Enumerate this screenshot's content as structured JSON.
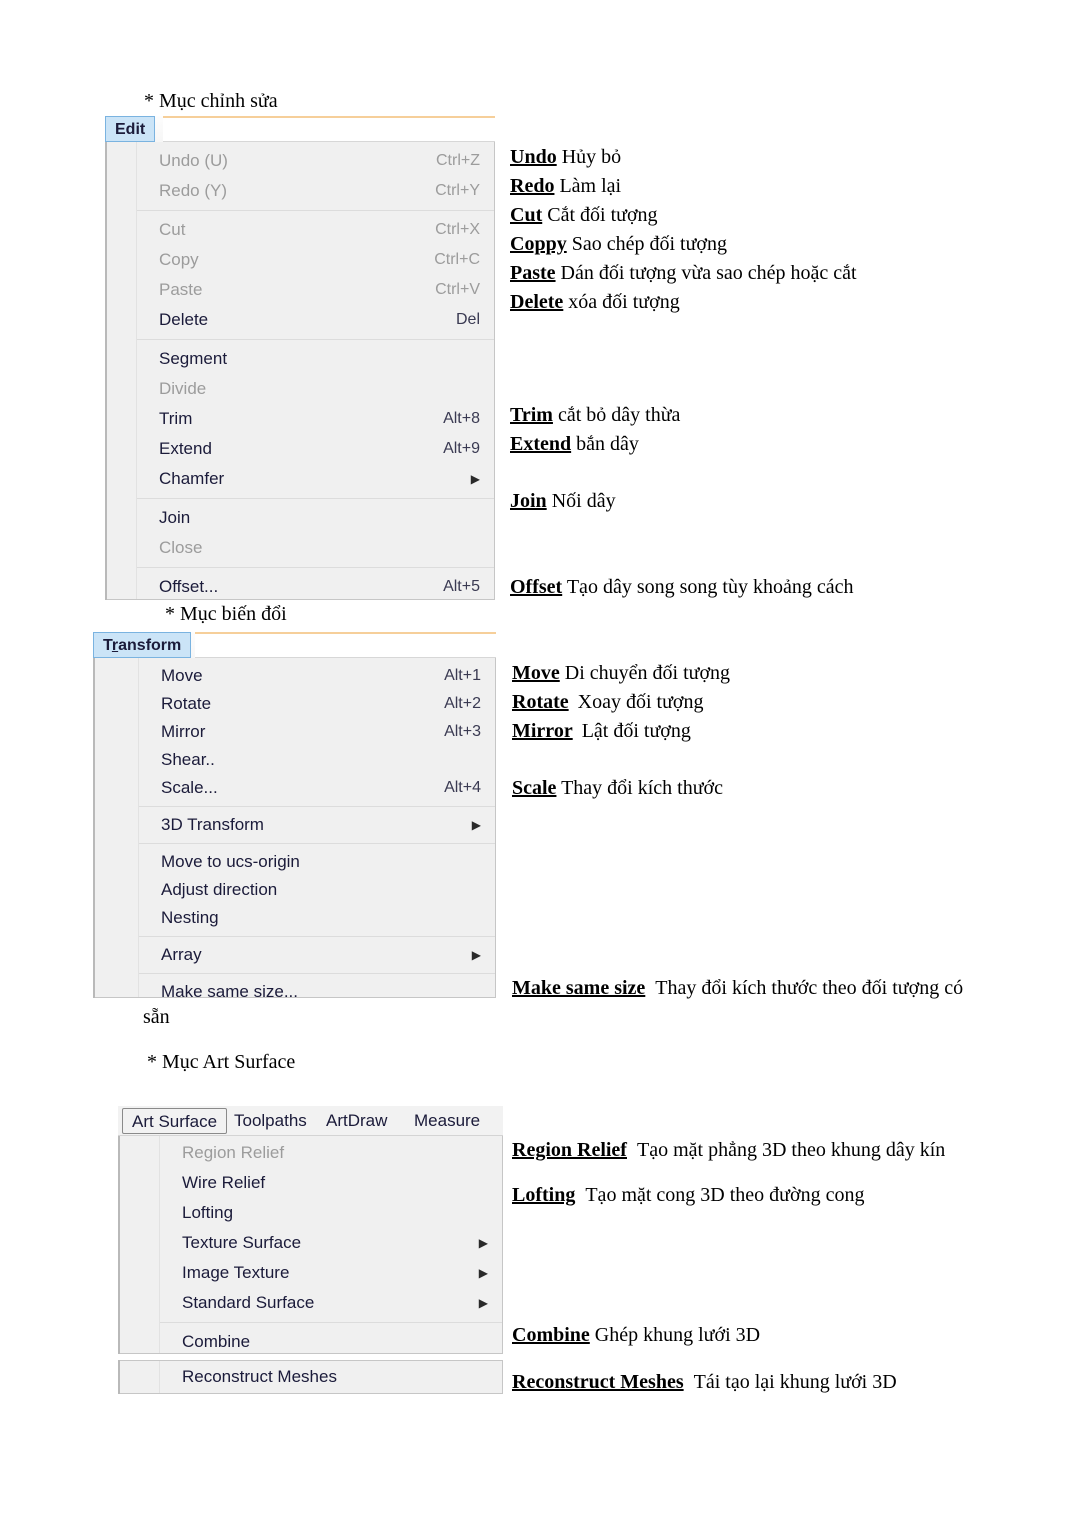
{
  "document": {
    "sections": [
      {
        "heading": "* Mục chỉnh sửa"
      },
      {
        "heading": "* Mục biến đổi"
      },
      {
        "heading": "* Mục Art Surface"
      }
    ],
    "overflow_line": "sẵn"
  },
  "edit_menu": {
    "tab_label": "Edit",
    "items": [
      {
        "label": "Undo (U)",
        "shortcut": "Ctrl+Z",
        "disabled": true,
        "arrow": false
      },
      {
        "label": "Redo (Y)",
        "shortcut": "Ctrl+Y",
        "disabled": true,
        "arrow": false
      },
      {
        "separator": true
      },
      {
        "label": "Cut",
        "shortcut": "Ctrl+X",
        "disabled": true,
        "arrow": false
      },
      {
        "label": "Copy",
        "shortcut": "Ctrl+C",
        "disabled": true,
        "arrow": false
      },
      {
        "label": "Paste",
        "shortcut": "Ctrl+V",
        "disabled": true,
        "arrow": false
      },
      {
        "label": "Delete",
        "shortcut": "Del",
        "disabled": false,
        "arrow": false
      },
      {
        "separator": true
      },
      {
        "label": "Segment",
        "shortcut": "",
        "disabled": false,
        "arrow": false
      },
      {
        "label": "Divide",
        "shortcut": "",
        "disabled": true,
        "arrow": false
      },
      {
        "label": "Trim",
        "shortcut": "Alt+8",
        "disabled": false,
        "arrow": false
      },
      {
        "label": "Extend",
        "shortcut": "Alt+9",
        "disabled": false,
        "arrow": false
      },
      {
        "label": "Chamfer",
        "shortcut": "",
        "disabled": false,
        "arrow": true
      },
      {
        "separator": true
      },
      {
        "label": "Join",
        "shortcut": "",
        "disabled": false,
        "arrow": false
      },
      {
        "label": "Close",
        "shortcut": "",
        "disabled": true,
        "arrow": false
      },
      {
        "separator": true
      },
      {
        "label": "Offset...",
        "shortcut": "Alt+5",
        "disabled": false,
        "arrow": false
      }
    ]
  },
  "edit_annotations": [
    {
      "term": "Undo",
      "desc": "Hủy bỏ"
    },
    {
      "term": "Redo",
      "desc": "Làm lại"
    },
    {
      "term": "Cut",
      "desc": "Cắt đối tượng"
    },
    {
      "term": "Coppy",
      "desc": "Sao chép đối tượng"
    },
    {
      "term": "Paste",
      "desc": "Dán đối tượng vừa sao chép hoặc cắt"
    },
    {
      "term": "Delete",
      "desc": "xóa đối tượng"
    },
    {
      "term": "Trim",
      "desc": "cắt bỏ dây thừa"
    },
    {
      "term": "Extend",
      "desc": "bắn dây"
    },
    {
      "term": "Join",
      "desc": "Nối dây"
    },
    {
      "term": "Offset",
      "desc": "Tạo dây song song tùy khoảng cách"
    }
  ],
  "transform_menu": {
    "tab_label_pre": "T",
    "tab_label_accel": "r",
    "tab_label_post": "ansform",
    "items": [
      {
        "label": "Move",
        "shortcut": "Alt+1",
        "disabled": false,
        "arrow": false
      },
      {
        "label": "Rotate",
        "shortcut": "Alt+2",
        "disabled": false,
        "arrow": false
      },
      {
        "label": "Mirror",
        "shortcut": "Alt+3",
        "disabled": false,
        "arrow": false
      },
      {
        "label": "Shear..",
        "shortcut": "",
        "disabled": false,
        "arrow": false
      },
      {
        "label": "Scale...",
        "shortcut": "Alt+4",
        "disabled": false,
        "arrow": false
      },
      {
        "separator": true
      },
      {
        "label": "3D Transform",
        "shortcut": "",
        "disabled": false,
        "arrow": true
      },
      {
        "separator": true
      },
      {
        "label": "Move to ucs-origin",
        "shortcut": "",
        "disabled": false,
        "arrow": false
      },
      {
        "label": "Adjust direction",
        "shortcut": "",
        "disabled": false,
        "arrow": false
      },
      {
        "label": "Nesting",
        "shortcut": "",
        "disabled": false,
        "arrow": false
      },
      {
        "separator": true
      },
      {
        "label": "Array",
        "shortcut": "",
        "disabled": false,
        "arrow": true
      },
      {
        "separator": true
      },
      {
        "label": "Make same size...",
        "shortcut": "",
        "disabled": false,
        "arrow": false
      }
    ]
  },
  "transform_annotations": [
    {
      "term": "Move",
      "desc": "Di chuyển đối tượng"
    },
    {
      "term": "Rotate",
      "desc": "Xoay đối tượng"
    },
    {
      "term": "Mirror",
      "desc": "Lật đối tượng"
    },
    {
      "term": "Scale",
      "desc": "Thay đổi kích thước"
    },
    {
      "term": "Make same size",
      "desc": "Thay đổi kích thước theo đối tượng có"
    }
  ],
  "art_surface_menu": {
    "bar_items": [
      "Art Surface",
      "Toolpaths",
      "ArtDraw",
      "Measure"
    ],
    "active_bar_item": "Art Surface",
    "items": [
      {
        "label": "Region Relief",
        "disabled": true,
        "arrow": false
      },
      {
        "label": "Wire Relief",
        "disabled": false,
        "arrow": false
      },
      {
        "label": "Lofting",
        "disabled": false,
        "arrow": false
      },
      {
        "label": "Texture Surface",
        "disabled": false,
        "arrow": true
      },
      {
        "label": "Image Texture",
        "disabled": false,
        "arrow": true
      },
      {
        "label": "Standard Surface",
        "disabled": false,
        "arrow": true
      },
      {
        "separator": true
      },
      {
        "label": "Combine",
        "disabled": false,
        "arrow": false
      }
    ],
    "detached_item": {
      "label": "Reconstruct Meshes",
      "disabled": false,
      "arrow": false
    }
  },
  "art_surface_annotations": [
    {
      "term": "Region Relief",
      "desc": "Tạo mặt phẳng 3D theo khung dây kín"
    },
    {
      "term": "Lofting",
      "desc": "Tạo mặt cong 3D theo đường cong"
    },
    {
      "term": "Combine",
      "desc": "Ghép khung lưới 3D"
    },
    {
      "term": "Reconstruct Meshes",
      "desc": "Tái tạo lại khung lưới 3D"
    }
  ],
  "colors": {
    "menu_bg": "#f0f0f0",
    "tab_highlight": "#cbe4f7",
    "tab_border": "#7ab3e0",
    "disabled_text": "#9c9c9c",
    "enabled_text": "#1b1b3a",
    "separator": "#dcdcdc"
  }
}
